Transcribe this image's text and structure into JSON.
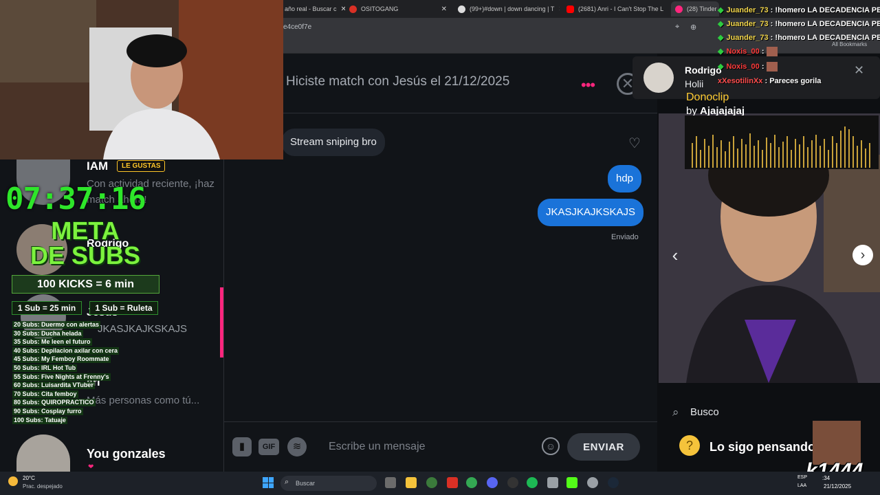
{
  "browser": {
    "tabs": [
      {
        "label": "año real - Buscar c",
        "icon": "search-tab-icon",
        "color": "#888888"
      },
      {
        "label": "OSITOGANG",
        "icon": "shield-tab-icon",
        "color": "#d93025"
      },
      {
        "label": "(99+)#down | down dancing | T",
        "icon": "tiktok-tab-icon",
        "color": "#ffffff"
      },
      {
        "label": "(2681) Anri - I Can't Stop The L",
        "icon": "youtube-tab-icon",
        "color": "#ff0000"
      },
      {
        "label": "(28) Tinder",
        "icon": "tinder-tab-icon",
        "color": "#fd267d"
      }
    ],
    "url_fragment": "e4ce0f7e",
    "bookmarks_all": "All Bookmarks"
  },
  "chat": {
    "match_text": "Hiciste match con Jesús el 21/12/2025",
    "more_icon": "•••",
    "close_icon": "✕",
    "messages": [
      {
        "text": "Stream sniping bro",
        "direction": "in"
      },
      {
        "text": "hdp",
        "direction": "out"
      },
      {
        "text": "JKASJKAJKSKAJS",
        "direction": "out"
      }
    ],
    "sent_status": "Enviado",
    "composer": {
      "gif_label": "GIF",
      "placeholder": "Escribe un mensaje",
      "send_label": "ENVIAR"
    }
  },
  "match_list": [
    {
      "name": "IAM",
      "badge": "LE GUSTAS",
      "preview": "Con actividad reciente, ¡haz match ahora!"
    },
    {
      "name": "Rodrigo",
      "preview": ""
    },
    {
      "name": "Jesús",
      "preview": "JKASJKAJKSKAJS"
    },
    {
      "name": "ari",
      "preview": "Más personas como tú..."
    },
    {
      "name": "You gonzales",
      "preview": "❤"
    }
  ],
  "stream": {
    "timer": "07:37:16",
    "meta_line1": "META",
    "meta_line2": "DE SUBS",
    "kicks": "100 KICKS = 6 min",
    "sub_rule1": "1 Sub = 25 min",
    "sub_rule2": "1 Sub = Ruleta",
    "goals": [
      "20 Subs: Duermo con alertas",
      "30 Subs: Ducha helada",
      "35 Subs: Me leen el futuro",
      "40 Subs: Depilacion axilar con cera",
      "45 Subs: My Femboy Roommate",
      "50 Subs: IRL Hot Tub",
      "55 Subs: Five Nights at Frenny's",
      "60 Subs: Luisardita VTuber",
      "70 Subs: Cita femboy",
      "80 Subs: QUIROPRACTICO",
      "90 Subs: Cosplay furro",
      "100 Subs: Tatuaje"
    ],
    "chat_lines": [
      {
        "user": "Juander_73",
        "text": "!homero LA DECADENCIA PE",
        "style": "gold"
      },
      {
        "user": "Juander_73",
        "text": "!homero LA DECADENCIA PE",
        "style": "gold"
      },
      {
        "user": "Juander_73",
        "text": "!homero LA DECADENCIA PE",
        "style": "gold"
      },
      {
        "user": "Noxis_00",
        "text": "",
        "style": "red"
      },
      {
        "user": "Noxis_00",
        "text": "",
        "style": "red"
      },
      {
        "user": "xXesotilinXx",
        "text": "Pareces gorila",
        "style": "red2"
      }
    ],
    "donoclip_title": "Donoclip",
    "donoclip_by_prefix": "by",
    "donoclip_by_user": "Ajajajajaj",
    "brand": "k1444"
  },
  "notification": {
    "name": "Rodrigo",
    "body": "Holii",
    "close": "✕"
  },
  "profile": {
    "busco_label": "Busco",
    "looking_for": "Lo sigo pensando",
    "prev_icon": "‹",
    "next_icon": "›"
  },
  "taskbar": {
    "weather_temp": "20°C",
    "weather_cond": "Prac. despejado",
    "search_placeholder": "Buscar",
    "lang_top": "ESP",
    "lang_bottom": "LAA",
    "clock_time": ":34",
    "clock_date": "21/12/2025"
  }
}
